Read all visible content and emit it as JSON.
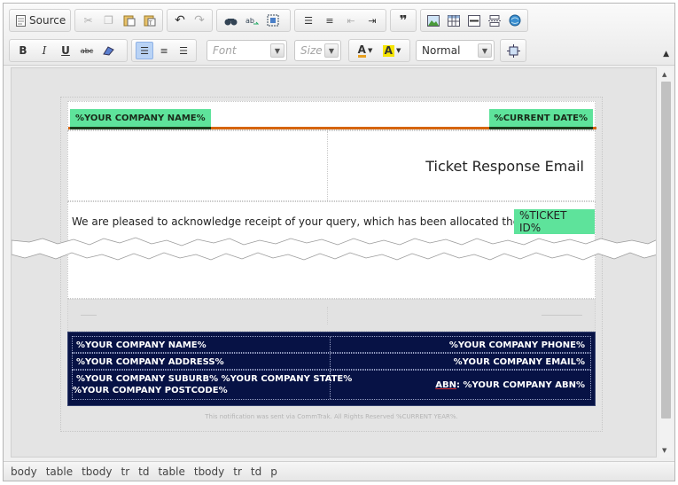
{
  "toolbar": {
    "source_label": "Source",
    "font_placeholder": "Font",
    "size_placeholder": "Size",
    "format_value": "Normal",
    "row1_icons": [
      "source-icon",
      "cut-icon",
      "copy-icon",
      "paste-icon",
      "paste-text-icon",
      "undo-icon",
      "redo-icon",
      "find-icon",
      "replace-icon",
      "select-all-icon",
      "numbered-list-icon",
      "bulleted-list-icon",
      "outdent-icon",
      "indent-icon",
      "blockquote-icon",
      "image-icon",
      "table-icon",
      "horizontal-line-icon",
      "page-break-icon",
      "link-icon"
    ],
    "row2_labels": {
      "bold": "B",
      "italic": "I",
      "underline": "U",
      "strike": "abc"
    }
  },
  "email": {
    "company_name_tag": "%YOUR COMPANY NAME%",
    "date_tag": "%CURRENT DATE%",
    "title": "Ticket Response Email",
    "body_text": "We are pleased to acknowledge receipt of your query, which has been allocated the Ticket ID:",
    "ticket_tag": "%TICKET ID%",
    "footer": {
      "row1_left": "%YOUR COMPANY NAME%",
      "row1_right": "%YOUR COMPANY PHONE%",
      "row2_left": "%YOUR COMPANY ADDRESS%",
      "row2_right": "%YOUR COMPANY EMAIL%",
      "row3_left_line1": "%YOUR COMPANY SUBURB% %YOUR COMPANY STATE%",
      "row3_left_line2": "%YOUR COMPANY POSTCODE%",
      "row3_right_prefix": "ABN",
      "row3_right_rest": ": %YOUR COMPANY ABN%"
    },
    "notice": "This notification was sent via CommTrak. All Rights Reserved %CURRENT YEAR%."
  },
  "statusbar": {
    "path": [
      "body",
      "table",
      "tbody",
      "tr",
      "td",
      "table",
      "tbody",
      "tr",
      "td",
      "p"
    ]
  },
  "colors": {
    "accent_green": "#5ee39b",
    "header_orange": "#d6650e",
    "footer_navy": "#071245"
  }
}
